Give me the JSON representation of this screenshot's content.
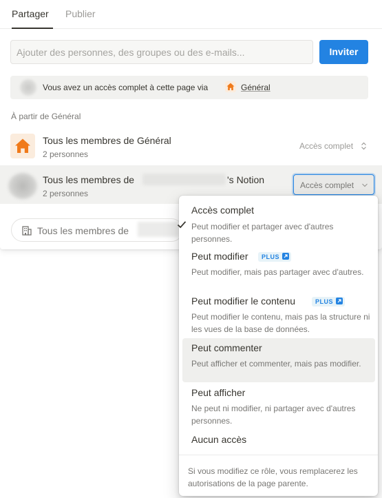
{
  "tabs": {
    "share_label": "Partager",
    "publish_label": "Publier"
  },
  "invite": {
    "placeholder": "Ajouter des personnes, des groupes ou des e-mails...",
    "button_label": "Inviter"
  },
  "info_bar": {
    "text": "Vous avez un accès complet à cette page via",
    "link_label": "Général"
  },
  "section_label": "À partir de Général",
  "members": [
    {
      "title": "Tous les membres de Général",
      "subtitle": "2 personnes",
      "access": "Accès complet"
    },
    {
      "title_prefix": "Tous les membres de",
      "title_suffix": "'s Notion",
      "subtitle": "2 personnes",
      "access": "Accès complet"
    }
  ],
  "bottom_input": {
    "text": "Tous les membres de"
  },
  "dropdown": {
    "options": [
      {
        "title": "Accès complet",
        "description": "Peut modifier et partager avec d'autres personnes.",
        "selected": true
      },
      {
        "title": "Peut modifier",
        "badge": "PLUS",
        "description": "Peut modifier, mais pas partager avec d'autres."
      },
      {
        "title": "Peut modifier le contenu",
        "badge": "PLUS",
        "description": "Peut modifier le contenu, mais pas la structure ni les vues de la base de données."
      },
      {
        "title": "Peut commenter",
        "description": "Peut afficher et commenter, mais pas modifier.",
        "hovered": true
      },
      {
        "title": "Peut afficher",
        "description": "Ne peut ni modifier, ni partager avec d'autres personnes."
      },
      {
        "title": "Aucun accès"
      }
    ],
    "footer": "Si vous modifiez ce rôle, vous remplacerez les autorisations de la page parente."
  },
  "colors": {
    "accent": "#2383e2",
    "home_icon": "#f07a1a",
    "home_bg": "#fbecdd"
  },
  "icons": [
    "home-icon",
    "chevron-updown-icon",
    "chevron-down-icon",
    "building-icon",
    "checkmark-icon",
    "external-link-icon"
  ]
}
